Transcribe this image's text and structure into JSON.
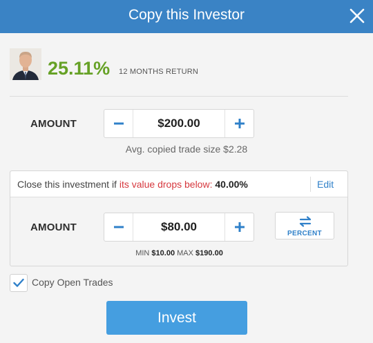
{
  "dialog": {
    "title": "Copy this Investor"
  },
  "investor": {
    "return_value": "25.11%",
    "return_label": "12 MONTHS RETURN"
  },
  "amount_section": {
    "label": "AMOUNT",
    "value": "$200.00",
    "avg_text": "Avg. copied trade size $2.28"
  },
  "stop_loss": {
    "prefix": "Close this investment if ",
    "highlight": "its value drops below",
    "colon": ": ",
    "percent": "40.00%",
    "edit_label": "Edit",
    "amount_label": "AMOUNT",
    "amount_value": "$80.00",
    "percent_button_label": "PERCENT",
    "min_label": "MIN",
    "min_value": "$10.00",
    "max_label": "MAX",
    "max_value": "$190.00"
  },
  "copy_open_trades": {
    "label": "Copy Open Trades",
    "checked": true
  },
  "invest_button": {
    "label": "Invest"
  },
  "colors": {
    "header": "#3a83c5",
    "return_green": "#66a126",
    "stepper_blue": "#2f80c9",
    "warning_red": "#d6383e",
    "invest_button": "#459ee0"
  },
  "icons": {
    "close": "close-icon",
    "minus": "minus-icon",
    "plus": "plus-icon",
    "swap": "swap-arrows-icon",
    "check": "checkmark-icon"
  }
}
